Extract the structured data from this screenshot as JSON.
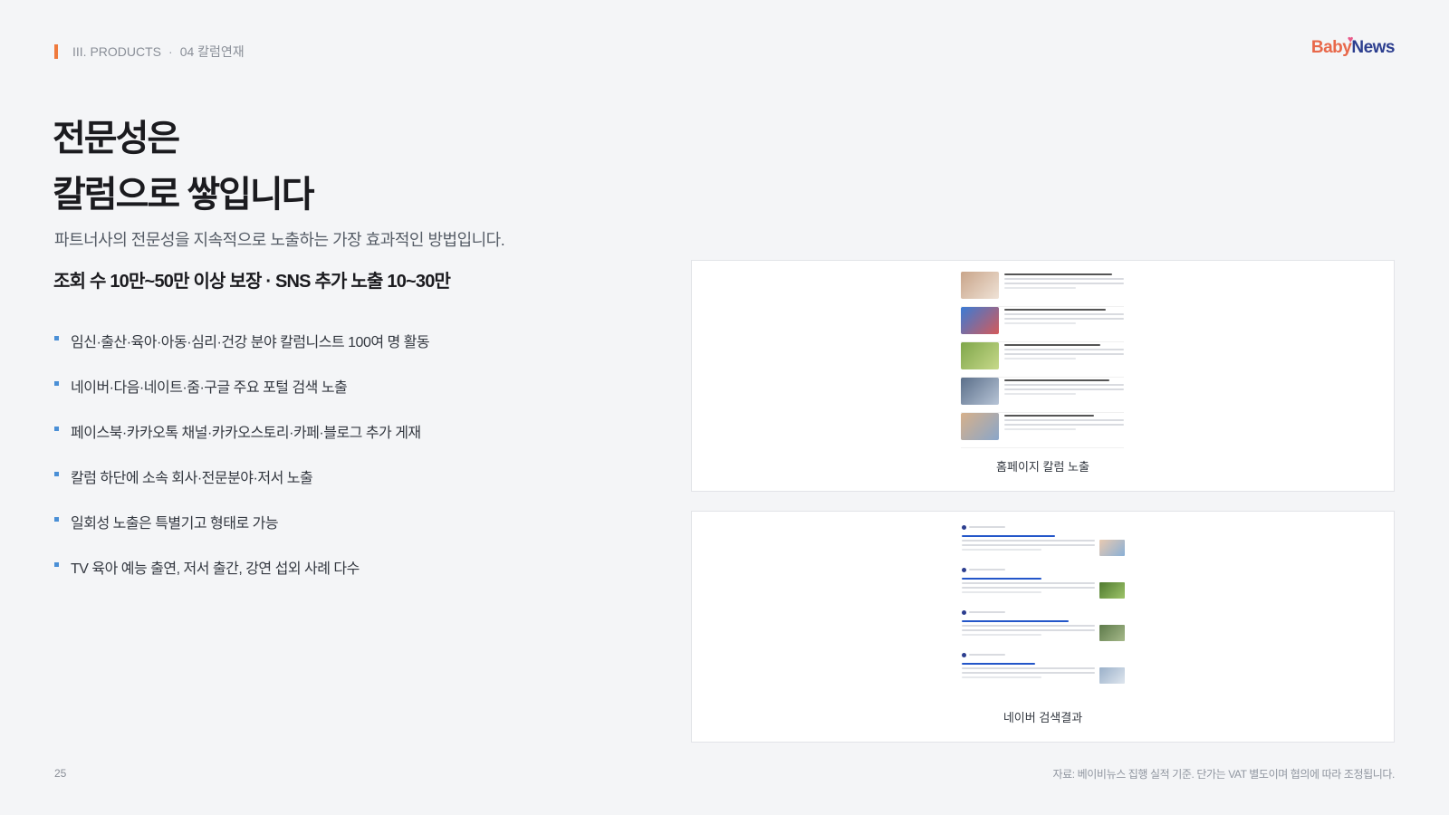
{
  "header": {
    "section": "III. PRODUCTS",
    "separator": "·",
    "subsection": "04 칼럼연재",
    "logo_baby": "Baby",
    "logo_news": "News"
  },
  "main": {
    "title_line1": "전문성은",
    "title_line2": "칼럼으로 쌓입니다",
    "subtitle": "파트너사의 전문성을 지속적으로 노출하는 가장 효과적인 방법입니다.",
    "highlight": "조회 수 10만~50만 이상 보장 · SNS 추가 노출 10~30만",
    "bullets": [
      "임신·출산·육아·아동·심리·건강 분야 칼럼니스트 100여 명 활동",
      "네이버·다음·네이트·줌·구글 주요 포털 검색 노출",
      "페이스북·카카오톡 채널·카카오스토리·카페·블로그 추가 게재",
      "칼럼 하단에 소속 회사·전문분야·저서 노출",
      "일회성 노출은 특별기고 형태로 가능",
      "TV 육아 예능 출연, 저서 출간, 강연 섭외 사례 다수"
    ]
  },
  "cards": {
    "home_caption": "홈페이지 칼럼 노출",
    "naver_caption": "네이버 검색결과"
  },
  "footer": {
    "page_number": "25",
    "note": "자료: 베이비뉴스 집행 실적 기준. 단가는 VAT 별도이며 협의에 따라 조정됩니다."
  },
  "colors": {
    "accent": "#ef7a3d",
    "bullet": "#4a8fd6",
    "background": "#f4f5f7"
  }
}
